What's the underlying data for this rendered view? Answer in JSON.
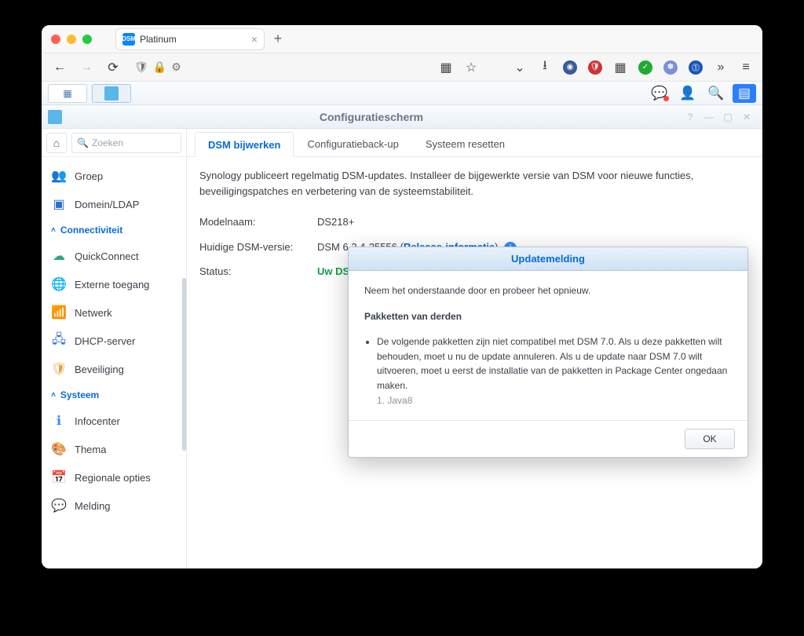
{
  "browser": {
    "tab_title": "Platinum",
    "toolbar_icons": [
      "grid",
      "star",
      "pocket",
      "download",
      "ext1",
      "ext2",
      "grid2",
      "check",
      "snow",
      "onepw",
      "more",
      "menu"
    ]
  },
  "dsm": {
    "window_title": "Configuratiescherm",
    "search_placeholder": "Zoeken",
    "sidebar": {
      "i0": {
        "label": "Groep"
      },
      "i1": {
        "label": "Domein/LDAP"
      },
      "s0": {
        "label": "Connectiviteit"
      },
      "i2": {
        "label": "QuickConnect"
      },
      "i3": {
        "label": "Externe toegang"
      },
      "i4": {
        "label": "Netwerk"
      },
      "i5": {
        "label": "DHCP-server"
      },
      "i6": {
        "label": "Beveiliging"
      },
      "s1": {
        "label": "Systeem"
      },
      "i7": {
        "label": "Infocenter"
      },
      "i8": {
        "label": "Thema"
      },
      "i9": {
        "label": "Regionale opties"
      },
      "i10": {
        "label": "Melding"
      }
    },
    "tabs": {
      "t0": "DSM bijwerken",
      "t1": "Configuratieback-up",
      "t2": "Systeem resetten"
    },
    "update": {
      "description": "Synology publiceert regelmatig DSM-updates. Installeer de bijgewerkte versie van DSM voor nieuwe functies, beveiligingspatches en verbetering van de systeemstabiliteit.",
      "model_label": "Modelnaam:",
      "model_value": "DS218+",
      "version_label": "Huidige DSM-versie:",
      "version_prefix": "DSM 6.2.4-25556 (",
      "version_link": "Release-informatie",
      "version_suffix": ")",
      "status_label": "Status:",
      "status_value": "Uw DSM-versie is up-to-date"
    }
  },
  "modal": {
    "title": "Updatemelding",
    "intro": "Neem het onderstaande door en probeer het opnieuw.",
    "section_title": "Pakketten van derden",
    "item_text": "De volgende pakketten zijn niet compatibel met DSM 7.0. Als u deze pakketten wilt behouden, moet u nu de update annuleren. Als u de update naar DSM 7.0 wilt uitvoeren, moet u eerst de installatie van de pakketten in Package Center ongedaan maken.",
    "pkg1": "1. Java8",
    "ok": "OK"
  }
}
